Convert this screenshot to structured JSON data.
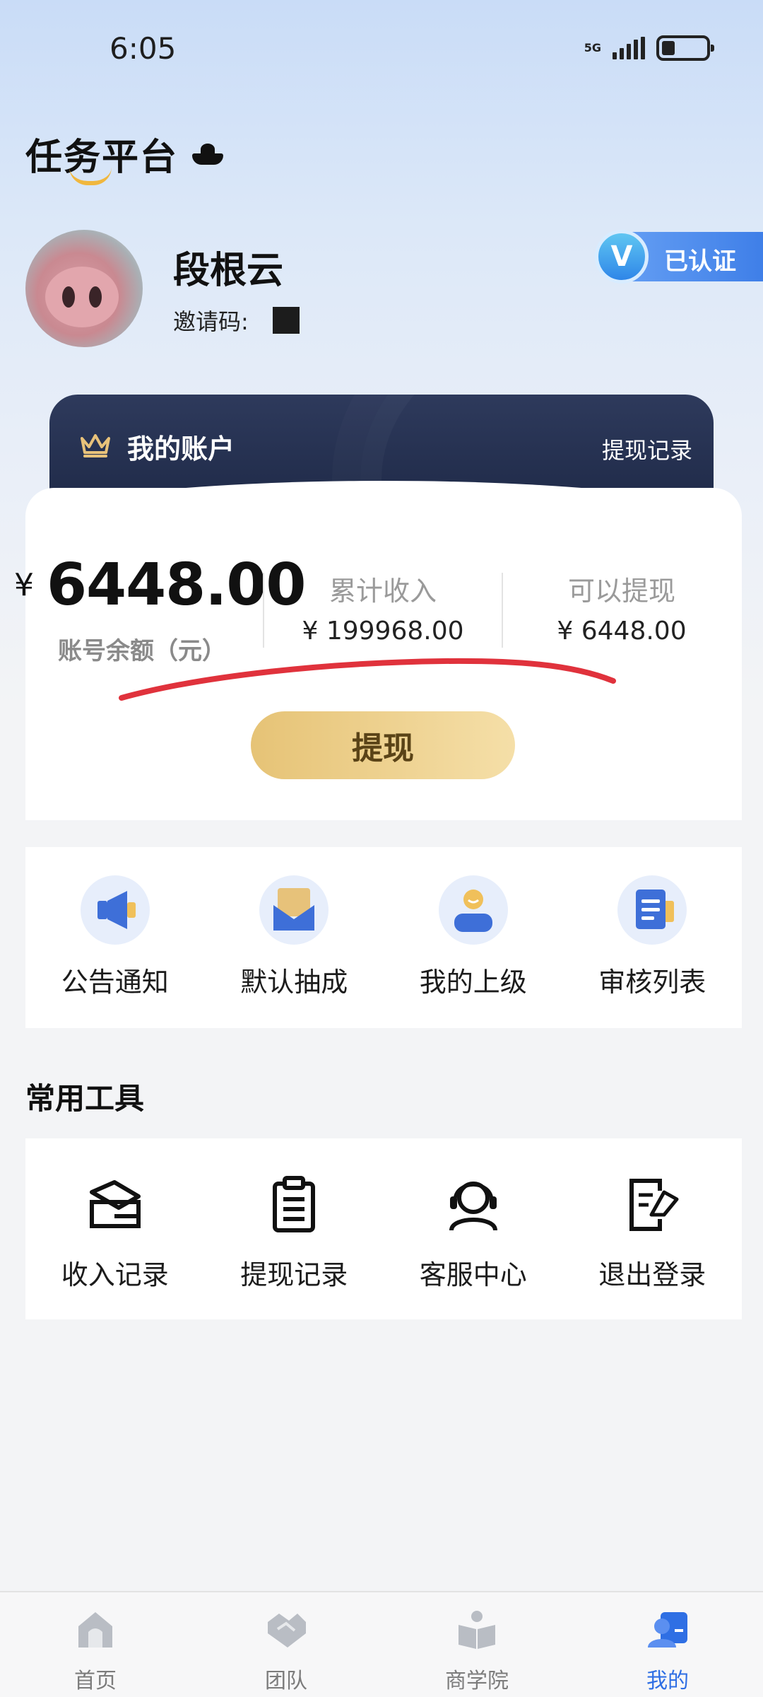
{
  "status_bar": {
    "time": "6:05",
    "network": "5G"
  },
  "header": {
    "app_title": "任务平台"
  },
  "profile": {
    "name": "段根云",
    "invite_label": "邀请码:",
    "verified_label": "已认证",
    "verified_icon": "V"
  },
  "account": {
    "title": "我的账户",
    "withdraw_record_link": "提现记录",
    "currency": "¥",
    "balance": "6448.00",
    "balance_label": "账号余额（元）",
    "total_income_label": "累计收入",
    "total_income_value": "¥ 199968.00",
    "withdrawable_label": "可以提现",
    "withdrawable_value": "¥ 6448.00",
    "withdraw_button": "提现"
  },
  "quick_menu": [
    {
      "label": "公告通知",
      "icon": "megaphone-icon"
    },
    {
      "label": "默认抽成",
      "icon": "envelope-icon"
    },
    {
      "label": "我的上级",
      "icon": "person-icon"
    },
    {
      "label": "审核列表",
      "icon": "document-list-icon"
    }
  ],
  "tools": {
    "title": "常用工具",
    "items": [
      {
        "label": "收入记录",
        "icon": "income-record-icon"
      },
      {
        "label": "提现记录",
        "icon": "clipboard-icon"
      },
      {
        "label": "客服中心",
        "icon": "headset-icon"
      },
      {
        "label": "退出登录",
        "icon": "logout-icon"
      }
    ]
  },
  "bottom_nav": [
    {
      "label": "首页",
      "icon": "home-icon",
      "active": false
    },
    {
      "label": "团队",
      "icon": "handshake-icon",
      "active": false
    },
    {
      "label": "商学院",
      "icon": "book-icon",
      "active": false
    },
    {
      "label": "我的",
      "icon": "profile-icon",
      "active": true
    }
  ],
  "colors": {
    "accent_blue": "#2f6fe4",
    "card_navy": "#23304f",
    "gold_button": "#e6c376",
    "annotation_red": "#e0323c"
  }
}
